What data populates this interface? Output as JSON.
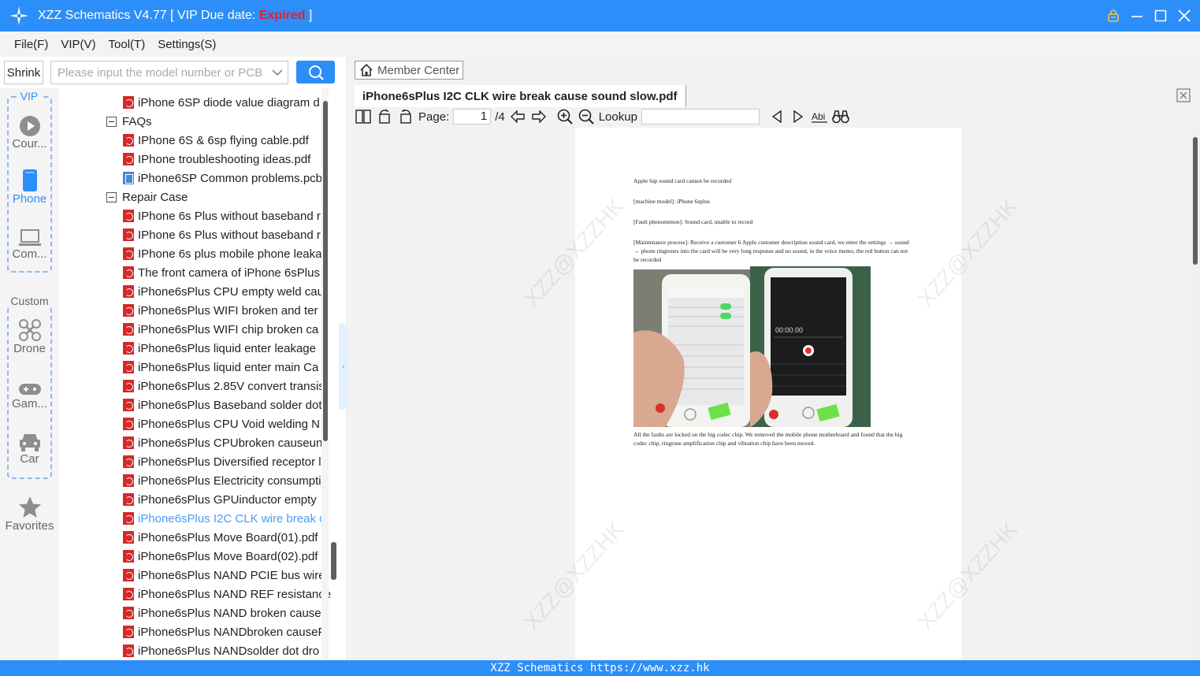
{
  "titlebar": {
    "app_title": "XZZ Schematics V4.77 [ VIP Due date: ",
    "vip_status": "Expired",
    "title_suffix": " ]",
    "accent_color": "#2c8ef8",
    "status_color": "#e5212d"
  },
  "menu": {
    "items": [
      "File(F)",
      "VIP(V)",
      "Tool(T)",
      "Settings(S)"
    ]
  },
  "search": {
    "shrink_label": "Shrink",
    "placeholder": "Please input the model number or PCB"
  },
  "categories": {
    "vip_label": "VIP",
    "vip_items": [
      {
        "label": "Cour...",
        "icon": "play-circle-icon"
      },
      {
        "label": "Phone",
        "icon": "phone-icon"
      },
      {
        "label": "Com...",
        "icon": "laptop-icon"
      }
    ],
    "custom_label": "Custom",
    "custom_items": [
      {
        "label": "Drone",
        "icon": "drone-icon"
      },
      {
        "label": "Gam...",
        "icon": "gamepad-icon"
      },
      {
        "label": "Car",
        "icon": "car-icon"
      }
    ],
    "favorites_label": "Favorites"
  },
  "tree": {
    "rows": [
      {
        "type": "file",
        "icon": "pdf",
        "label": "iPhone 6SP diode value diagram d"
      },
      {
        "type": "folder",
        "label": "FAQs"
      },
      {
        "type": "file",
        "icon": "pdf",
        "label": "IPhone 6S & 6sp flying cable.pdf"
      },
      {
        "type": "file",
        "icon": "pdf",
        "label": "IPhone troubleshooting ideas.pdf"
      },
      {
        "type": "file",
        "icon": "pcb",
        "label": "iPhone6SP Common problems.pcb"
      },
      {
        "type": "folder",
        "label": "Repair Case"
      },
      {
        "type": "file",
        "icon": "pdf",
        "label": "IPhone 6s Plus without baseband r"
      },
      {
        "type": "file",
        "icon": "pdf",
        "label": "IPhone 6s Plus without baseband r"
      },
      {
        "type": "file",
        "icon": "pdf",
        "label": "IPhone 6s plus mobile phone leaka"
      },
      {
        "type": "file",
        "icon": "pdf",
        "label": "The front camera of iPhone 6sPlus"
      },
      {
        "type": "file",
        "icon": "pdf",
        "label": "iPhone6sPlus  CPU empty weld cau"
      },
      {
        "type": "file",
        "icon": "pdf",
        "label": "iPhone6sPlus  WIFI broken and ter"
      },
      {
        "type": "file",
        "icon": "pdf",
        "label": "iPhone6sPlus  WIFI chip broken ca"
      },
      {
        "type": "file",
        "icon": "pdf",
        "label": "iPhone6sPlus  liquid enter leakage"
      },
      {
        "type": "file",
        "icon": "pdf",
        "label": "iPhone6sPlus  liquid enter main Ca"
      },
      {
        "type": "file",
        "icon": "pdf",
        "label": "iPhone6sPlus 2.85V convert transis"
      },
      {
        "type": "file",
        "icon": "pdf",
        "label": "iPhone6sPlus Baseband solder dot"
      },
      {
        "type": "file",
        "icon": "pdf",
        "label": "iPhone6sPlus CPU Void welding N"
      },
      {
        "type": "file",
        "icon": "pdf",
        "label": "iPhone6sPlus CPUbroken causeun"
      },
      {
        "type": "file",
        "icon": "pdf",
        "label": "iPhone6sPlus Diversified receptor l"
      },
      {
        "type": "file",
        "icon": "pdf",
        "label": "iPhone6sPlus Electricity consumpti"
      },
      {
        "type": "file",
        "icon": "pdf",
        "label": "iPhone6sPlus GPUinductor empty"
      },
      {
        "type": "file",
        "icon": "pdf",
        "label": "iPhone6sPlus I2C CLK wire break  c",
        "selected": true
      },
      {
        "type": "file",
        "icon": "pdf",
        "label": "iPhone6sPlus Move Board(01).pdf"
      },
      {
        "type": "file",
        "icon": "pdf",
        "label": "iPhone6sPlus Move Board(02).pdf"
      },
      {
        "type": "file",
        "icon": "pdf",
        "label": "iPhone6sPlus NAND PCIE bus wire"
      },
      {
        "type": "file",
        "icon": "pdf",
        "label": "iPhone6sPlus NAND REF resistance"
      },
      {
        "type": "file",
        "icon": "pdf",
        "label": "iPhone6sPlus NAND broken cause"
      },
      {
        "type": "file",
        "icon": "pdf",
        "label": "iPhone6sPlus NANDbroken causeF"
      },
      {
        "type": "file",
        "icon": "pdf",
        "label": "iPhone6sPlus NANDsolder dot dro"
      }
    ]
  },
  "viewer": {
    "member_center": "Member Center",
    "tab_title": "iPhone6sPlus I2C CLK wire break  cause sound slow.pdf",
    "page_label": "Page:",
    "page_current": "1",
    "page_total": "/4",
    "lookup_label": "Lookup",
    "watermark": "XZZ@XZZHK"
  },
  "document": {
    "line1": "Apple 6sp sound card cannot be recorded",
    "line2": "[machine model]: iPhone 6splus",
    "line3": "[Fault phenomenon]: Sound card, unable to record",
    "line4": "[Maintenance process]: Receive a customer 6 Apple customer description sound card, we enter the settings → sound → phone ringtones into the card will be very long response and no sound, in the voice memo, the red button can not be recorded",
    "photo2_time": "00:00.00",
    "line5": "All the faults are locked on the big codec chip. We removed the mobile phone motherboard and found that the big codec chip, ringtone amplification chip and vibration chip have been moved."
  },
  "status": {
    "text": "XZZ Schematics https://www.xzz.hk"
  }
}
